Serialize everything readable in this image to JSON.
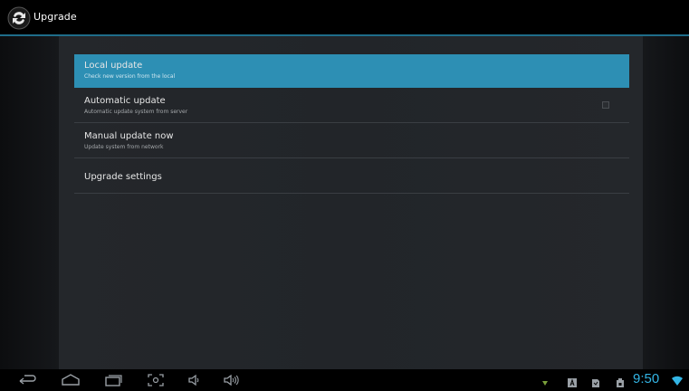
{
  "app": {
    "title": "Upgrade",
    "icon": "upgrade-sync-icon"
  },
  "preferences": [
    {
      "title": "Local update",
      "summary": "Check new version from the local",
      "selected": true
    },
    {
      "title": "Automatic update",
      "summary": "Automatic update system from server",
      "has_checkbox": true,
      "checked": false
    },
    {
      "title": "Manual update now",
      "summary": "Update system from network"
    },
    {
      "title": "Upgrade settings"
    }
  ],
  "navbar": {
    "buttons": [
      "back-icon",
      "home-icon",
      "recent-apps-icon",
      "screenshot-icon",
      "volume-down-icon",
      "volume-up-icon"
    ]
  },
  "status": {
    "time": "9:50",
    "icons": [
      "download-icon",
      "keyboard-icon",
      "sd-card-icon",
      "usb-storage-icon",
      "wifi-icon"
    ]
  },
  "colors": {
    "accent": "#33b5e5",
    "selected_row": "#2d8fb4",
    "actionbar_divider": "#1f6d8a"
  }
}
